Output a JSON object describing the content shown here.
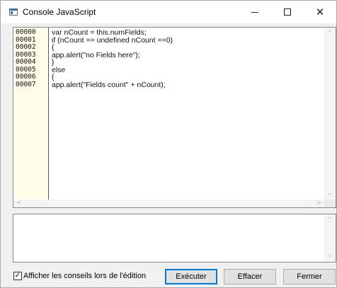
{
  "window": {
    "title": "Console JavaScript",
    "controls": {
      "minimize_icon": "minimize-icon",
      "maximize_icon": "maximize-icon",
      "close_icon": "close-icon",
      "close_glyph": "✕"
    }
  },
  "editor": {
    "line_numbers": [
      "00000",
      "00001",
      "00002",
      "00003",
      "00004",
      "00005",
      "00006",
      "00007"
    ],
    "lines": [
      "var nCount = this.numFields;",
      "if (nCount == undefined nCount ==0)",
      "{",
      "app.alert(\"no Fields here\");",
      "}",
      "else",
      "{",
      "app.alert(\"Fields count\" + nCount);"
    ],
    "gutter_color": "#fffde7"
  },
  "output": {
    "text": ""
  },
  "footer": {
    "checkbox_label": "Afficher les conseils lors de l'édition",
    "checkbox_checked": true,
    "execute_label": "Exécuter",
    "clear_label": "Effacer",
    "close_label": "Fermer"
  },
  "colors": {
    "accent": "#0078d7",
    "app_icon": "#1e74d0"
  }
}
